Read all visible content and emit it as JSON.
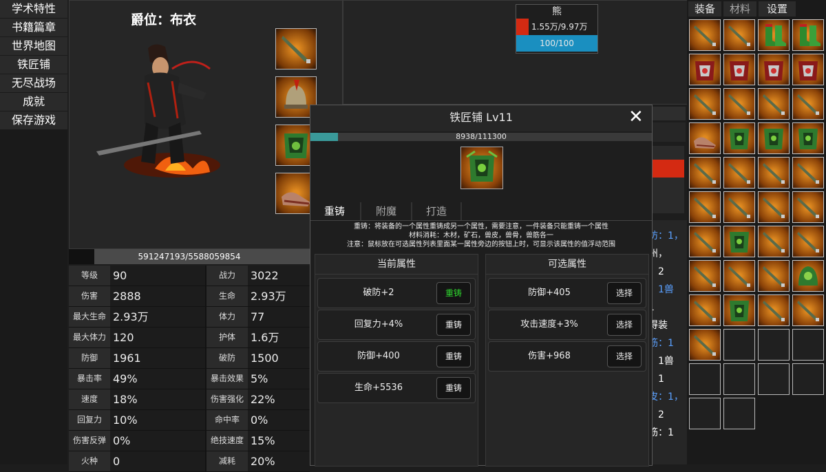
{
  "menu": [
    "学术特性",
    "书籍篇章",
    "世界地图",
    "铁匠铺",
    "无尽战场",
    "成就",
    "保存游戏"
  ],
  "character": {
    "rank": "爵位：布衣",
    "exp_text": "591247193/5588059854",
    "exp_fraction": 0.106
  },
  "stats": [
    [
      "等级",
      "90",
      "战力",
      "3022"
    ],
    [
      "伤害",
      "2888",
      "生命",
      "2.93万"
    ],
    [
      "最大生命",
      "2.93万",
      "体力",
      "77"
    ],
    [
      "最大体力",
      "120",
      "护体",
      "1.6万"
    ],
    [
      "防御",
      "1961",
      "破防",
      "1500"
    ],
    [
      "暴击率",
      "49%",
      "暴击效果",
      "5%"
    ],
    [
      "速度",
      "18%",
      "伤害强化",
      "22%"
    ],
    [
      "回复力",
      "10%",
      "命中率",
      "0%"
    ],
    [
      "伤害反弹",
      "0%",
      "绝技速度",
      "15%"
    ],
    [
      "火种",
      "0",
      "减耗",
      "20%"
    ]
  ],
  "enemy": {
    "name": "熊",
    "hp_text": "1.55万/9.97万",
    "hp_fraction": 0.155,
    "mp_text": "100/100",
    "hp_color": "#d42a12",
    "mp_color": "#1a8fc0"
  },
  "right_tabs": [
    "装备",
    "材料",
    "设置"
  ],
  "inventory": [
    "sword",
    "sword",
    "green-boots",
    "green-boots",
    "red-armor",
    "red-armor",
    "red-armor",
    "red-armor",
    "sword",
    "sword",
    "sword",
    "sword",
    "leather-boots",
    "green-armor",
    "green-armor",
    "green-armor",
    "sword",
    "sword",
    "sword",
    "sword",
    "sword",
    "sword",
    "sword",
    "sword",
    "sword",
    "green-armor",
    "sword",
    "sword",
    "sword",
    "sword",
    "sword",
    "green-helmet",
    "sword",
    "green-armor",
    "sword",
    "sword",
    "sword",
    "empty",
    "empty",
    "empty",
    "empty",
    "empty",
    "empty",
    "empty",
    "empty",
    "empty"
  ],
  "background_text": [
    "防：1，",
    "州，",
    "：2",
    "：1兽",
    "1",
    "得装",
    "筋：1",
    "：1兽",
    "：1",
    "皮：1，",
    "：2",
    "筋：1"
  ],
  "blacksmith": {
    "title": "铁匠铺 Lv11",
    "close": "✕",
    "progress_text": "8938/111300",
    "progress_fraction": 0.08,
    "tabs": [
      "重铸",
      "附魔",
      "打造"
    ],
    "desc_lines": [
      "重铸：将装备的一个属性重铸成另一个属性，需要注意，一件装备只能重铸一个属性",
      "材料消耗：木材，矿石，兽皮，兽骨，兽筋各一",
      "注意：鼠标放在可选属性列表里面某一属性旁边的按钮上时，可显示该属性的值浮动范围"
    ],
    "current_header": "当前属性",
    "options_header": "可选属性",
    "current": [
      {
        "label": "破防+2",
        "button": "重铸",
        "active": true
      },
      {
        "label": "回复力+4%",
        "button": "重铸",
        "active": false
      },
      {
        "label": "防御+400",
        "button": "重铸",
        "active": false
      },
      {
        "label": "生命+5536",
        "button": "重铸",
        "active": false
      }
    ],
    "options": [
      {
        "label": "防御+405",
        "button": "选择"
      },
      {
        "label": "攻击速度+3%",
        "button": "选择"
      },
      {
        "label": "伤害+968",
        "button": "选择"
      }
    ],
    "active_color": "#2ed52e"
  }
}
